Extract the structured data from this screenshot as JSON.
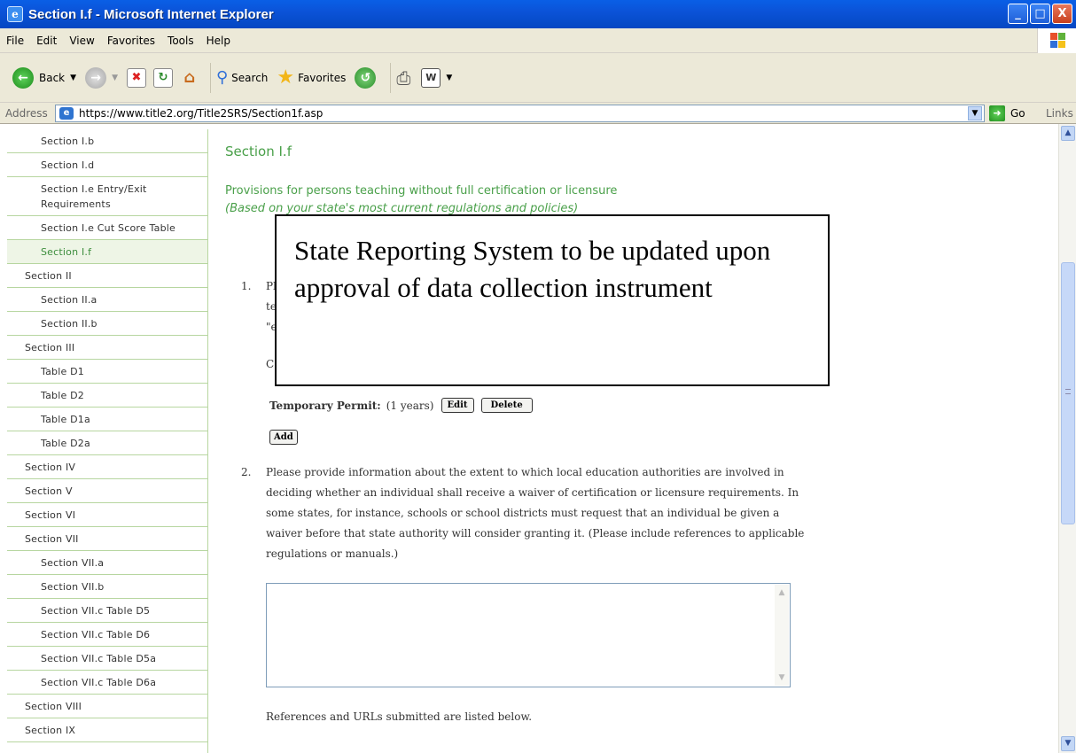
{
  "window": {
    "title": "Section I.f - Microsoft Internet Explorer",
    "buttons": [
      "_",
      "□",
      "X"
    ]
  },
  "menu": [
    "File",
    "Edit",
    "View",
    "Favorites",
    "Tools",
    "Help"
  ],
  "toolbar": {
    "back_label": "Back",
    "search_label": "Search",
    "favorites_label": "Favorites"
  },
  "address": {
    "label": "Address",
    "url": "https://www.title2.org/Title2SRS/Section1f.asp",
    "go_label": "Go",
    "links_label": "Links"
  },
  "sidebar": {
    "items": [
      {
        "label": "Section I.b",
        "level": 2
      },
      {
        "label": "Section I.d",
        "level": 2
      },
      {
        "label": "Section I.e Entry/Exit Requirements",
        "level": 2
      },
      {
        "label": "Section I.e Cut Score Table",
        "level": 2
      },
      {
        "label": "Section I.f",
        "level": 2,
        "active": true
      },
      {
        "label": "Section II",
        "level": 1
      },
      {
        "label": "Section II.a",
        "level": 2
      },
      {
        "label": "Section II.b",
        "level": 2
      },
      {
        "label": "Section III",
        "level": 1
      },
      {
        "label": "Table D1",
        "level": 2
      },
      {
        "label": "Table D2",
        "level": 2
      },
      {
        "label": "Table D1a",
        "level": 2
      },
      {
        "label": "Table D2a",
        "level": 2
      },
      {
        "label": "Section IV",
        "level": 1
      },
      {
        "label": "Section V",
        "level": 1
      },
      {
        "label": "Section VI",
        "level": 1
      },
      {
        "label": "Section VII",
        "level": 1
      },
      {
        "label": "Section VII.a",
        "level": 2
      },
      {
        "label": "Section VII.b",
        "level": 2
      },
      {
        "label": "Section VII.c Table D5",
        "level": 2
      },
      {
        "label": "Section VII.c Table D6",
        "level": 2
      },
      {
        "label": "Section VII.c Table D5a",
        "level": 2
      },
      {
        "label": "Section VII.c Table D6a",
        "level": 2
      },
      {
        "label": "Section VIII",
        "level": 1
      },
      {
        "label": "Section IX",
        "level": 1
      }
    ]
  },
  "main": {
    "title": "Section I.f",
    "subtitle": "Provisions for persons teaching without full certification or licensure",
    "subtitle_italic": "(Based on your state's most current regulations and policies)",
    "q1": {
      "number": "1.",
      "line1": "Pl",
      "line2": "te",
      "line3": "\"e",
      "line4": "C"
    },
    "permit": {
      "label": "Temporary Permit:",
      "years": "(1 years)",
      "edit_label": "Edit",
      "delete_label": "Delete"
    },
    "add_label": "Add",
    "q2": {
      "number": "2.",
      "text": "Please provide information about the extent to which local education authorities are involved in deciding whether an individual shall receive a waiver of certification or licensure requirements. In some states, for instance, schools or school districts must request that an individual be given a waiver before that state authority will consider granting it. (Please include references to applicable regulations or manuals.)",
      "answer": ""
    },
    "references_text": "References and URLs submitted are listed below."
  },
  "overlay": {
    "text": "State Reporting System to be updated upon approval of data collection instrument"
  }
}
